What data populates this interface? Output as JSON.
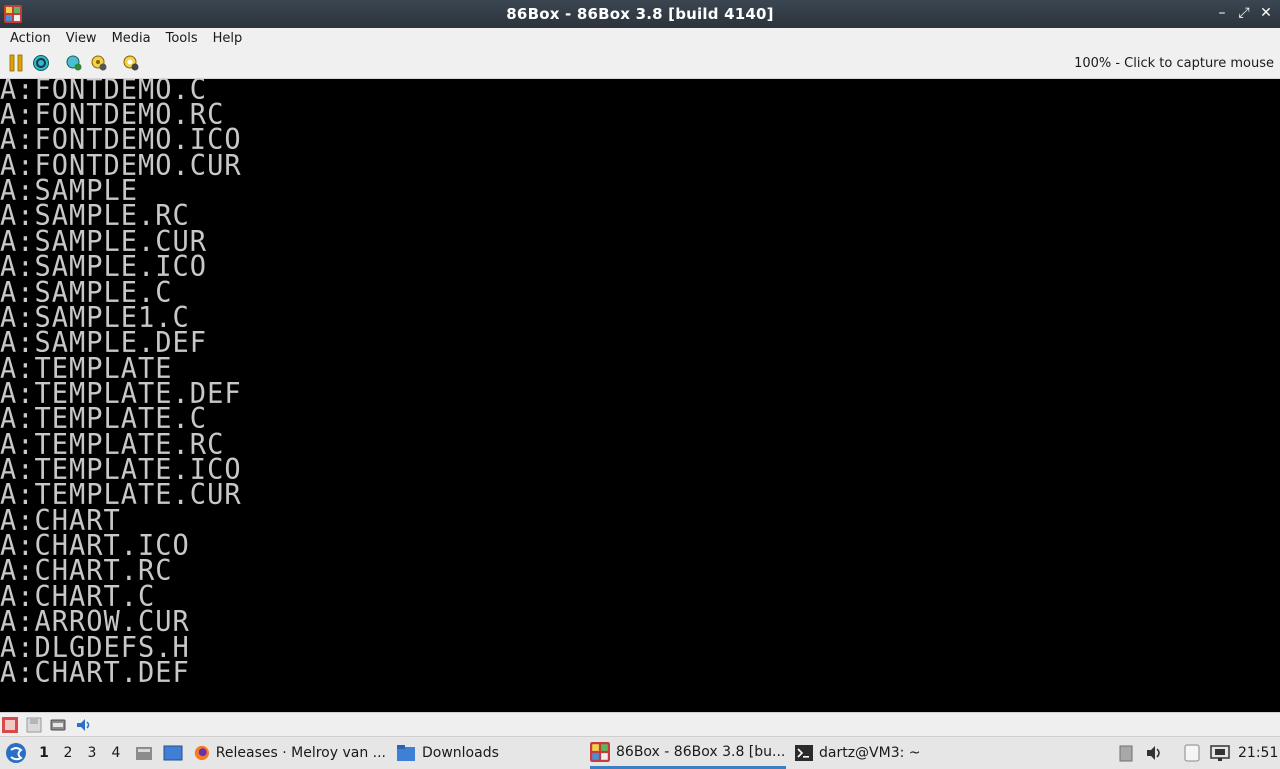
{
  "window": {
    "title": "86Box - 86Box 3.8 [build 4140]",
    "controls": [
      "–",
      "⤢",
      "✕"
    ]
  },
  "menu": [
    "Action",
    "View",
    "Media",
    "Tools",
    "Help"
  ],
  "toolbar": {
    "icons": [
      "pause-icon",
      "ctrl-alt-del-icon",
      "hard-reset-icon",
      "settings-icon",
      "screenshot-icon"
    ],
    "capture_text": "100% - Click to capture mouse"
  },
  "screen": {
    "lines": [
      "A:FONTDEMO.C",
      "A:FONTDEMO.RC",
      "A:FONTDEMO.ICO",
      "A:FONTDEMO.CUR",
      "A:SAMPLE",
      "A:SAMPLE.RC",
      "A:SAMPLE.CUR",
      "A:SAMPLE.ICO",
      "A:SAMPLE.C",
      "A:SAMPLE1.C",
      "A:SAMPLE.DEF",
      "A:TEMPLATE",
      "A:TEMPLATE.DEF",
      "A:TEMPLATE.C",
      "A:TEMPLATE.RC",
      "A:TEMPLATE.ICO",
      "A:TEMPLATE.CUR",
      "A:CHART",
      "A:CHART.ICO",
      "A:CHART.RC",
      "A:CHART.C",
      "A:ARROW.CUR",
      "A:DLGDEFS.H",
      "A:CHART.DEF"
    ]
  },
  "statusbar": {
    "icons": [
      "machine-icon",
      "floppy-icon",
      "hdd-icon",
      "sound-icon"
    ]
  },
  "taskbar": {
    "workspaces": [
      "1",
      "2",
      "3",
      "4"
    ],
    "tasks": [
      {
        "label": "Releases · Melroy van ...",
        "icon": "firefox-icon"
      },
      {
        "label": "Downloads",
        "icon": "folder-icon"
      },
      {
        "label": "86Box - 86Box 3.8 [bu...",
        "icon": "86box-icon"
      },
      {
        "label": "dartz@VM3: ~",
        "icon": "terminal-icon"
      }
    ],
    "clock": "21:51"
  }
}
